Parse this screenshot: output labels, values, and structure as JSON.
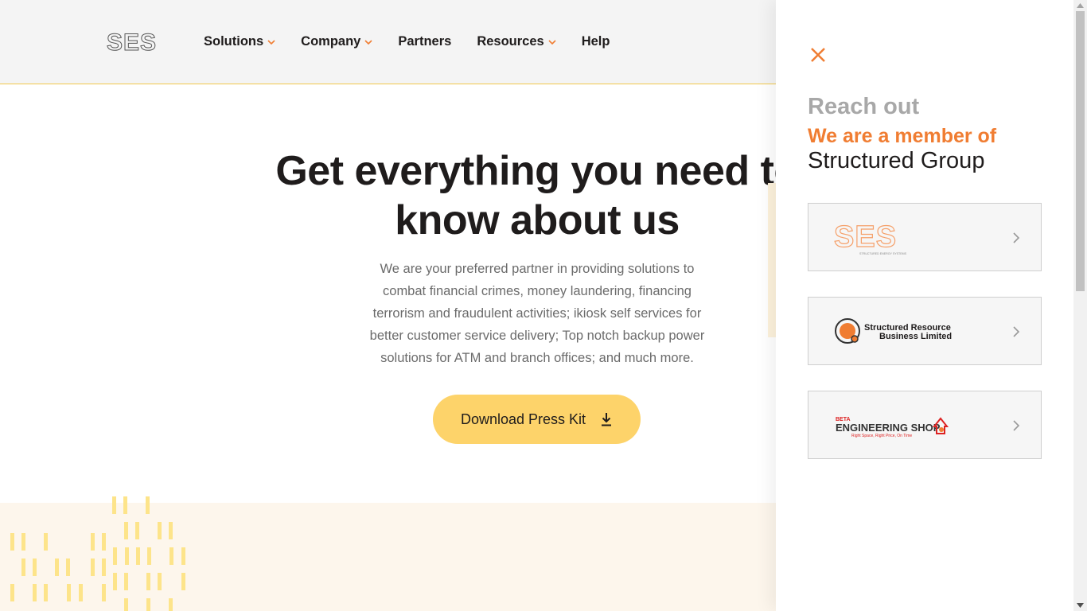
{
  "header": {
    "logo_text": "SES",
    "nav": [
      {
        "label": "Solutions",
        "has_dropdown": true
      },
      {
        "label": "Company",
        "has_dropdown": true
      },
      {
        "label": "Partners",
        "has_dropdown": false
      },
      {
        "label": "Resources",
        "has_dropdown": true
      },
      {
        "label": "Help",
        "has_dropdown": false
      }
    ]
  },
  "hero": {
    "title_line1": "Get everything you need to",
    "title_line2": "know about us",
    "description": "We are your preferred partner in providing solutions to combat financial crimes, money laundering, financing terrorism and fraudulent activities; ikiosk self services for better customer service delivery; Top notch backup power solutions for ATM and branch offices; and much more.",
    "button_label": "Download Press Kit"
  },
  "drawer": {
    "reach_out": "Reach out",
    "member_of": "We are a member of",
    "group_name": "Structured Group",
    "companies": [
      {
        "logo_text": "SES",
        "logo_subtext": "STRUCTURED ENERGY SYSTEMS"
      },
      {
        "logo_text_line1": "Structured Resource",
        "logo_text_line2": "Business Limited"
      },
      {
        "logo_text_top": "BETA",
        "logo_text": "ENGINEERING SHOP",
        "logo_tagline": "Right Space, Right Price, On Time"
      }
    ]
  },
  "colors": {
    "accent_orange": "#f07d32",
    "button_yellow": "#fdd36a",
    "header_bg": "#f4f4f4",
    "band_bg": "#fdf6ec",
    "deco_yellow": "#fde48a"
  },
  "icons": {
    "close": "close-icon",
    "download": "download-icon",
    "chevron_down": "chevron-down-icon",
    "chevron_right": "chevron-right-icon"
  }
}
